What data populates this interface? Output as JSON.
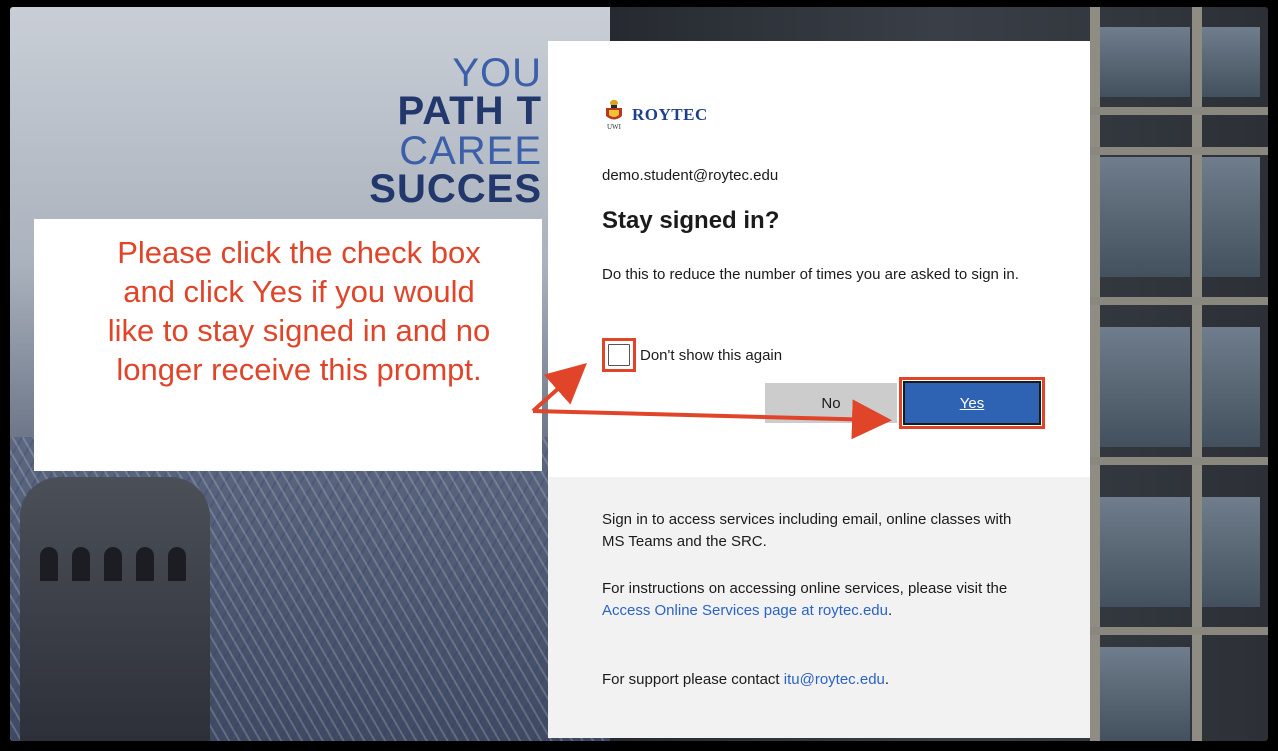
{
  "poster": {
    "line1": "YOU",
    "line2": "PATH T",
    "line3": "CAREE",
    "line4": "SUCCES"
  },
  "callout": {
    "line1": "Please click the check box",
    "line2": "and click Yes if you would",
    "line3": "like to stay signed in and no",
    "line4": "longer receive this prompt."
  },
  "dialog": {
    "brand": "ROYTEC",
    "logo_caption": "UWI",
    "email": "demo.student@roytec.edu",
    "title": "Stay signed in?",
    "description": "Do this to reduce the number of times you are asked to sign in.",
    "checkbox_label": "Don't show this again",
    "checkbox_checked": false,
    "no_label": "No",
    "yes_label": "Yes"
  },
  "info": {
    "p1": "Sign in to access services including email, online classes with MS Teams and the SRC.",
    "p2_prefix": "For instructions on accessing online services, please visit the ",
    "p2_link": "Access Online Services page at roytec.edu",
    "p2_suffix": ".",
    "p3_prefix": "For support please contact ",
    "p3_link": "itu@roytec.edu",
    "p3_suffix": "."
  },
  "colors": {
    "accent_red": "#e0452a",
    "button_blue": "#2e63b4",
    "link_blue": "#2b64c6",
    "brand_blue": "#1e3f8f"
  },
  "icons": [
    "uwi-crest-icon",
    "arrow-icon"
  ]
}
